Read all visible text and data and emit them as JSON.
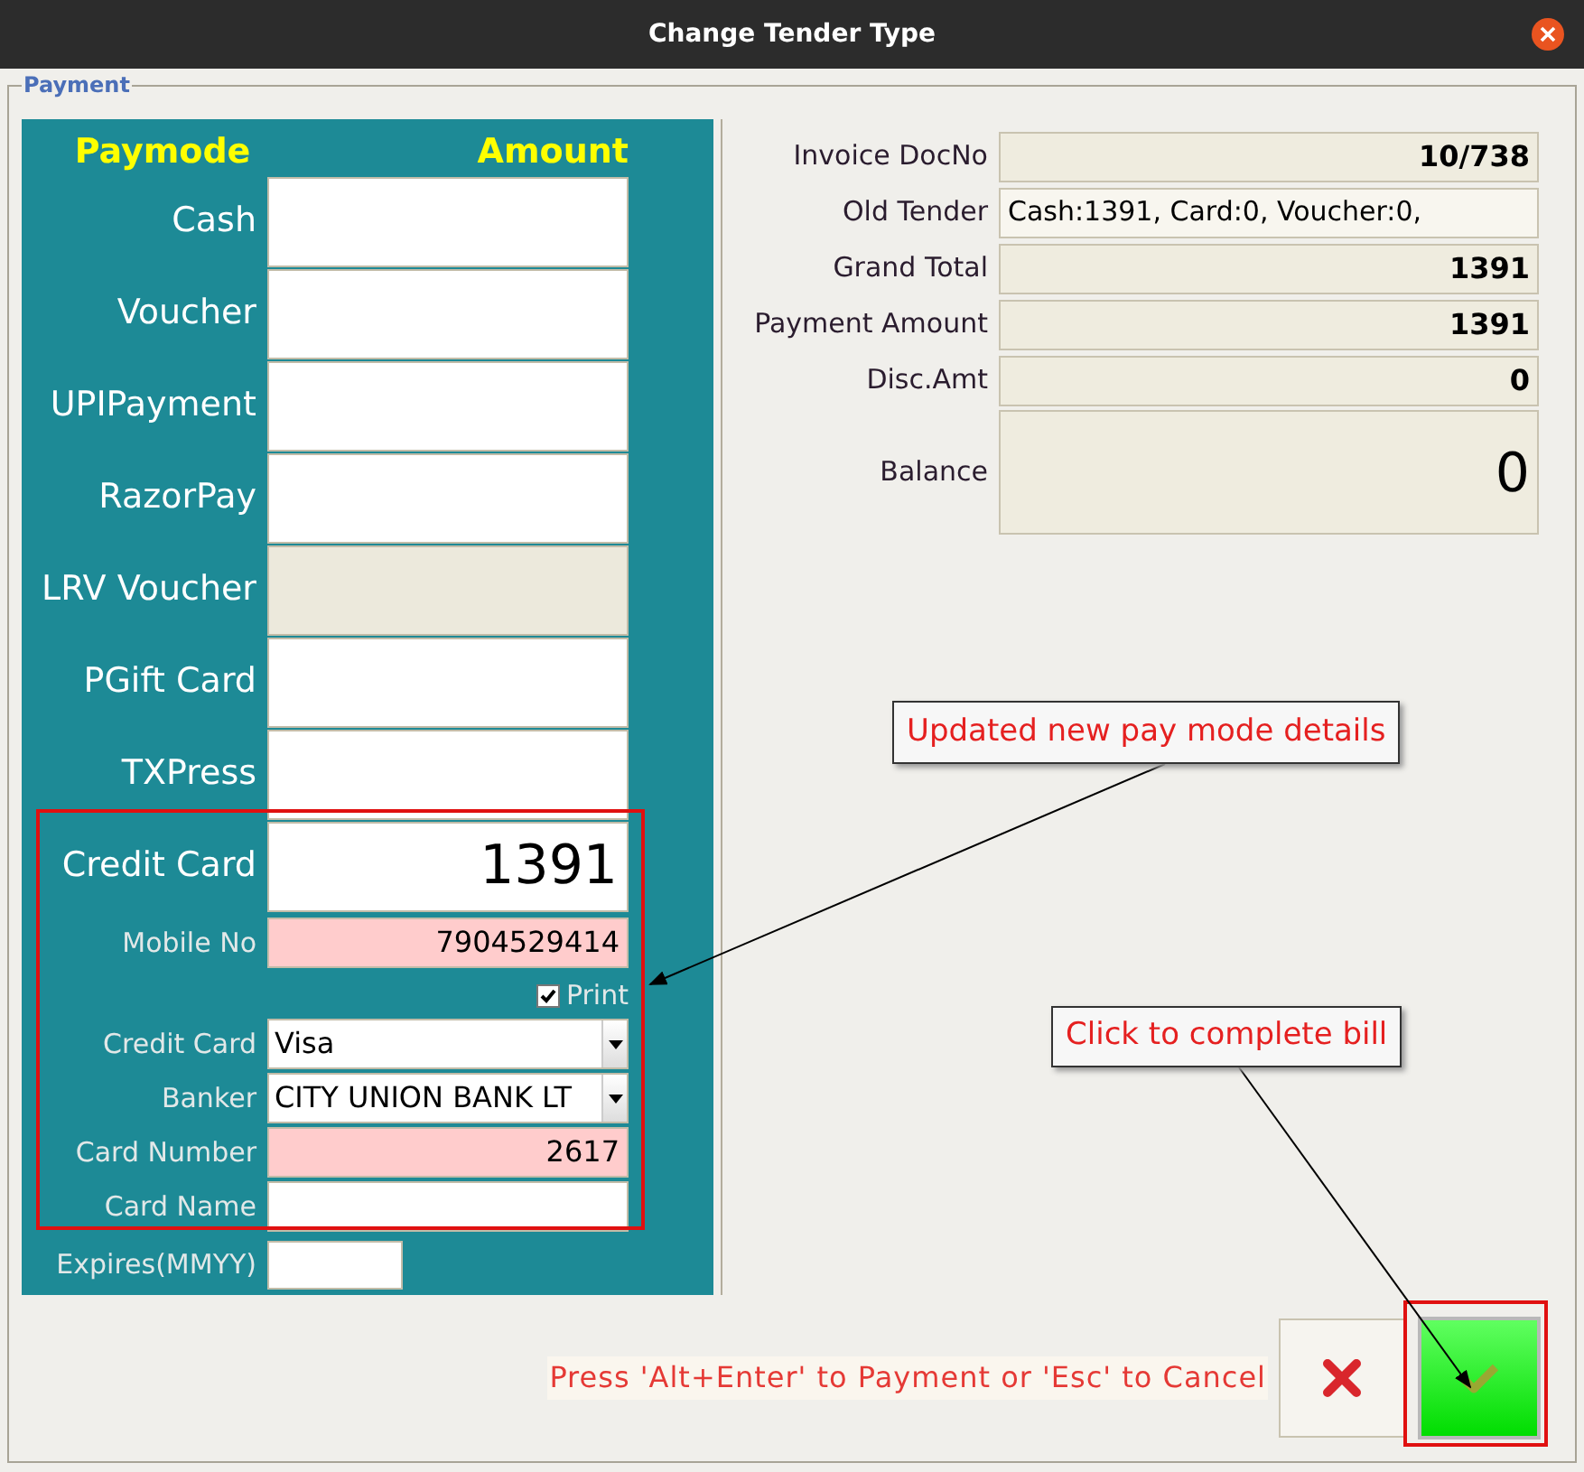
{
  "window": {
    "title": "Change Tender Type"
  },
  "group_label": "Payment",
  "headers": {
    "paymode": "Paymode",
    "amount": "Amount"
  },
  "paymodes": [
    {
      "label": "Cash",
      "disabled": false
    },
    {
      "label": "Voucher",
      "disabled": false
    },
    {
      "label": "UPIPayment",
      "disabled": false
    },
    {
      "label": "RazorPay",
      "disabled": false
    },
    {
      "label": "LRV Voucher",
      "disabled": true
    },
    {
      "label": "PGift Card",
      "disabled": false
    },
    {
      "label": "TXPress",
      "disabled": false
    },
    {
      "label": "Credit Card",
      "value": "1391",
      "disabled": false
    }
  ],
  "card_details": [
    {
      "kind": "text",
      "label": "Mobile No",
      "value": "7904529414",
      "required": true
    },
    {
      "kind": "checkbox",
      "label": "Print",
      "checked": true
    },
    {
      "kind": "combo",
      "label": "Credit Card",
      "value": "Visa"
    },
    {
      "kind": "combo",
      "label": "Banker",
      "value": "CITY UNION BANK LT"
    },
    {
      "kind": "text",
      "label": "Card Number",
      "value": "2617",
      "required": true
    },
    {
      "kind": "text",
      "label": "Card Name",
      "required": false
    },
    {
      "kind": "short",
      "label": "Expires(MMYY)"
    }
  ],
  "summary": [
    {
      "label": "Invoice DocNo",
      "value": "10/738",
      "kind": "bold"
    },
    {
      "label": "Old Tender",
      "value": "Cash:1391, Card:0, Voucher:0,",
      "kind": "plain"
    },
    {
      "label": "Grand Total",
      "value": "1391",
      "kind": "bold"
    },
    {
      "label": "Payment Amount",
      "value": "1391",
      "kind": "bold"
    },
    {
      "label": "Disc.Amt",
      "value": "0",
      "kind": "bold"
    },
    {
      "label": "Balance",
      "value": "0",
      "kind": "large"
    }
  ],
  "hint": "Press 'Alt+Enter' to Payment or 'Esc' to Cancel",
  "callouts": [
    "Updated new pay mode details",
    "Click to complete bill"
  ]
}
